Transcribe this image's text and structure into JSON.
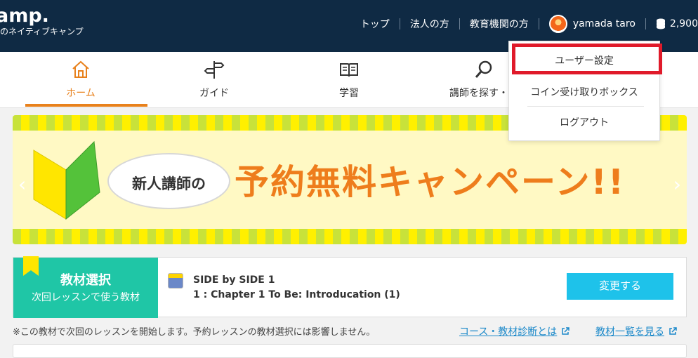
{
  "brand": {
    "name": "amp.",
    "tagline": "のネイティブキャンプ"
  },
  "topnav": {
    "items": [
      "トップ",
      "法人の方",
      "教育機関の方"
    ],
    "user_name": "yamada taro",
    "coins": "2,900"
  },
  "dropdown": {
    "items": [
      "ユーザー設定",
      "コイン受け取りボックス",
      "ログアウト"
    ]
  },
  "nav": {
    "items": [
      {
        "label": "ホーム",
        "icon": "home-icon"
      },
      {
        "label": "ガイド",
        "icon": "signpost-icon"
      },
      {
        "label": "学習",
        "icon": "book-icon"
      },
      {
        "label": "講師を探す・予",
        "icon": "search-icon"
      }
    ]
  },
  "banner": {
    "bubble": "新人講師の",
    "headline": "予約無料キャンペーン!!"
  },
  "material": {
    "title": "教材選択",
    "subtitle": "次回レッスンで使う教材",
    "book_title": "SIDE by SIDE 1",
    "chapter": "1 : Chapter 1 To Be: Introducation (1)",
    "button": "変更する"
  },
  "footer": {
    "note": "※この教材で次回のレッスンを開始します。予約レッスンの教材選択には影響しません。",
    "link1": "コース・教材診断とは",
    "link2": "教材一覧を見る"
  },
  "colors": {
    "header_bg": "#0f2a44",
    "accent_orange": "#e8811c",
    "teal": "#1fc6a6",
    "button_blue": "#1ec2ea",
    "highlight_red": "#e01a2a",
    "link_blue": "#1a88c9"
  }
}
